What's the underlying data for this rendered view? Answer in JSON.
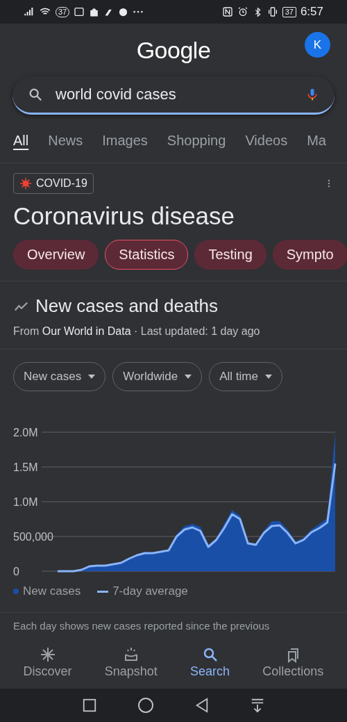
{
  "status_bar": {
    "notification_count": "37",
    "battery": "37",
    "time": "6:57"
  },
  "header": {
    "logo": "Google",
    "avatar": "K"
  },
  "search": {
    "value": "world covid cases"
  },
  "tabs": [
    {
      "label": "All",
      "selected": true
    },
    {
      "label": "News",
      "selected": false
    },
    {
      "label": "Images",
      "selected": false
    },
    {
      "label": "Shopping",
      "selected": false
    },
    {
      "label": "Videos",
      "selected": false
    },
    {
      "label": "Ma",
      "selected": false
    }
  ],
  "topic": {
    "tag": "COVID-19",
    "title": "Coronavirus disease"
  },
  "chips": [
    {
      "label": "Overview",
      "selected": false
    },
    {
      "label": "Statistics",
      "selected": true
    },
    {
      "label": "Testing",
      "selected": false
    },
    {
      "label": "Sympto",
      "selected": false
    }
  ],
  "card": {
    "title": "New cases and deaths",
    "source_prefix": "From",
    "source_link": "Our World in Data",
    "updated": "· Last updated: 1 day ago",
    "filters": [
      "New cases",
      "Worldwide",
      "All time"
    ],
    "chart_data": {
      "type": "area",
      "grid": true,
      "ylim": [
        0,
        2000000
      ],
      "yticks": [
        {
          "value": 0,
          "label": "0"
        },
        {
          "value": 500000,
          "label": "500,000"
        },
        {
          "value": 1000000,
          "label": "1.0M"
        },
        {
          "value": 1500000,
          "label": "1.5M"
        },
        {
          "value": 2000000,
          "label": "2.0M"
        }
      ],
      "series": [
        {
          "name": "New cases",
          "type": "area",
          "color": "#1a4fa8",
          "values": [
            0,
            0,
            0,
            30000,
            80000,
            90000,
            90000,
            110000,
            130000,
            190000,
            240000,
            280000,
            270000,
            290000,
            310000,
            530000,
            650000,
            680000,
            640000,
            380000,
            470000,
            680000,
            880000,
            800000,
            420000,
            400000,
            580000,
            720000,
            720000,
            600000,
            430000,
            480000,
            600000,
            680000,
            760000,
            2000000
          ]
        },
        {
          "name": "7-day average",
          "type": "line",
          "color": "#8ab4f8",
          "values": [
            0,
            0,
            0,
            20000,
            70000,
            80000,
            80000,
            100000,
            120000,
            180000,
            230000,
            260000,
            260000,
            280000,
            300000,
            500000,
            600000,
            630000,
            580000,
            350000,
            450000,
            620000,
            820000,
            750000,
            400000,
            380000,
            550000,
            650000,
            660000,
            550000,
            400000,
            450000,
            560000,
            620000,
            700000,
            1550000
          ]
        }
      ]
    },
    "note": "Each day shows new cases reported since the previous"
  },
  "bottom_nav": [
    {
      "label": "Discover",
      "selected": false
    },
    {
      "label": "Snapshot",
      "selected": false
    },
    {
      "label": "Search",
      "selected": true
    },
    {
      "label": "Collections",
      "selected": false
    }
  ]
}
